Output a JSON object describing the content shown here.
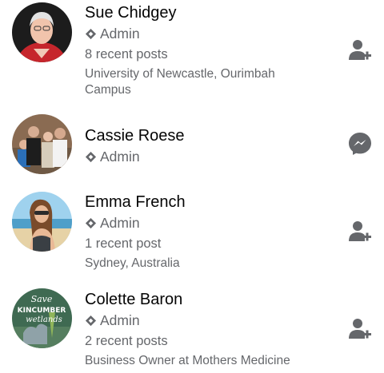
{
  "members": [
    {
      "name": "Sue Chidgey",
      "role": "Admin",
      "posts": "8 recent posts",
      "detail": "University of Newcastle, Ourimbah Campus",
      "action_icon": "add-friend-icon"
    },
    {
      "name": "Cassie Roese",
      "role": "Admin",
      "action_icon": "messenger-icon"
    },
    {
      "name": "Emma French",
      "role": "Admin",
      "posts": "1 recent post",
      "detail": "Sydney, Australia",
      "action_icon": "add-friend-icon"
    },
    {
      "name": "Colette Baron",
      "role": "Admin",
      "posts": "2 recent posts",
      "detail": "Business Owner at Mothers Medicine",
      "action_icon": "add-friend-icon",
      "avatar_text": {
        "line1": "Save",
        "line2": "KINCUMBER",
        "line3": "wetlands"
      }
    }
  ],
  "colors": {
    "primary_text": "#050505",
    "secondary_text": "#65676b",
    "icon": "#65676b"
  }
}
